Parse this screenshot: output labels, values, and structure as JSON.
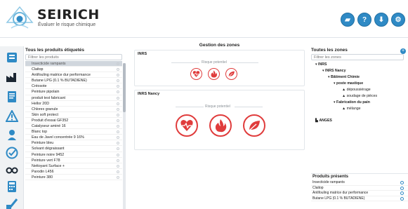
{
  "header": {
    "brand": "SEIRICH",
    "tagline": "Évaluer le risque chimique",
    "buttons": [
      {
        "name": "folder-icon",
        "glyph": "▰"
      },
      {
        "name": "help-icon",
        "glyph": "?"
      },
      {
        "name": "download-icon",
        "glyph": "⬇"
      },
      {
        "name": "settings-icon",
        "glyph": "⚙"
      }
    ]
  },
  "left": {
    "title": "Tous les produits étiquetés",
    "filter_placeholder": "Filtrer les produits",
    "products": [
      "Insecticide rampants",
      "Claitop",
      "Antifouling matrice dur performance",
      "Butane LPG (0.1 % BUTADIENE)",
      "Créosote",
      "Peinture pipolain",
      "produit test fabricant",
      "Hellor 20D",
      "Chlorex granule",
      "Skin soft protect",
      "Produit d'essai GF352",
      "Catalyseur aminé 16",
      "Blanc top",
      "Eau de Javel concentrée 9 16%",
      "Peinture bleu",
      "Solvant dégraissant",
      "Peinture noire 9452",
      "Peinture vert F78",
      "Nettoyant Surface +",
      "Parodin L456",
      "Peinture 380"
    ]
  },
  "main": {
    "title": "Gestion des zones",
    "risk_label": "Risque potentiel",
    "zones": [
      {
        "name": "INRS"
      },
      {
        "name": "INRS Nancy"
      }
    ]
  },
  "right": {
    "title": "Toutes les zones",
    "filter_placeholder": "Filtrer les zones",
    "tree": [
      {
        "label": "INRS",
        "level": 0,
        "kind": "site"
      },
      {
        "label": "INRS Nancy",
        "level": 1,
        "kind": "site"
      },
      {
        "label": "Bâtiment Chimie",
        "level": 2,
        "kind": "site"
      },
      {
        "label": "poste mastique",
        "level": 3,
        "kind": "post"
      },
      {
        "label": "dépoussiérage",
        "level": 4,
        "kind": "worker"
      },
      {
        "label": "soudage de pièces",
        "level": 4,
        "kind": "worker"
      },
      {
        "label": "Fabrication du pain",
        "level": 3,
        "kind": "post"
      },
      {
        "label": "mélange",
        "level": 4,
        "kind": "worker"
      },
      {
        "label": "ANGES",
        "level": 0,
        "kind": "site"
      }
    ],
    "presents_title": "Produits présents",
    "presents": [
      "Insecticide rampants",
      "Claitop",
      "Antifouling matrice dur performance",
      "Butane LPG (0.1 % BUTADIENE)"
    ]
  },
  "colors": {
    "accent": "#2f8ac5",
    "risk": "#e03c3c",
    "selected_row": "#d0d6dd"
  }
}
